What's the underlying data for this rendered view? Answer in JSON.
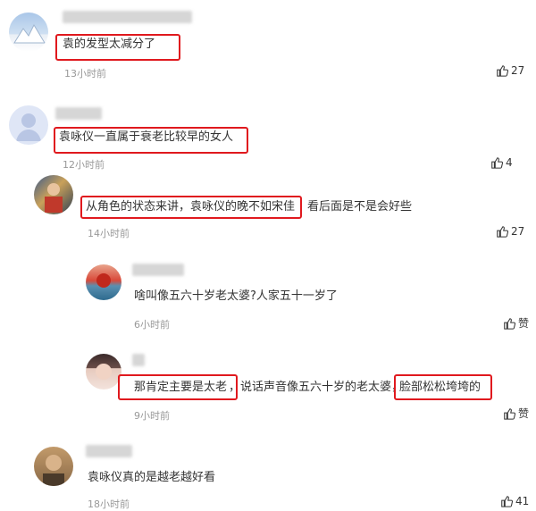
{
  "comments": [
    {
      "text": "袁的发型太减分了",
      "time": "13小时前",
      "likes": "27"
    },
    {
      "text": "袁咏仪一直属于衰老比较早的女人",
      "time": "12小时前",
      "likes": "4"
    },
    {
      "text": "从角色的状态来讲，袁咏仪的晚不如宋佳",
      "text_extra": "看后面是不是会好些",
      "time": "14小时前",
      "likes": "27"
    },
    {
      "text": "啥叫像五六十岁老太婆?人家五十一岁了",
      "time": "6小时前",
      "likes": "赞"
    },
    {
      "text_part1": "那肯定主要是太老",
      "text_part2": "，说话声音像五六十岁的老太婆，",
      "text_part3": "脸部松松垮垮的",
      "time": "9小时前",
      "likes": "赞"
    },
    {
      "text": "袁咏仪真的是越老越好看",
      "time": "18小时前",
      "likes": "41"
    }
  ],
  "icons": {
    "like": "thumbs-up-icon"
  },
  "colors": {
    "highlight": "#e0191e",
    "time": "#999999"
  }
}
